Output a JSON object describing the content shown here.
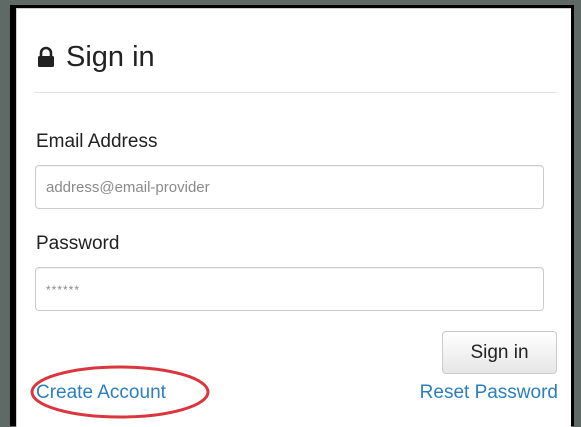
{
  "heading": {
    "icon": "lock-icon",
    "title": "Sign in"
  },
  "email": {
    "label": "Email Address",
    "placeholder": "address@email-provider"
  },
  "password": {
    "label": "Password",
    "placeholder": "******"
  },
  "actions": {
    "sign_in_label": "Sign in",
    "create_account_label": "Create Account",
    "reset_password_label": "Reset Password"
  },
  "colors": {
    "link": "#2a7fc0",
    "highlight": "#d9363e",
    "text": "#222222",
    "backdrop": "#5f6a66"
  }
}
